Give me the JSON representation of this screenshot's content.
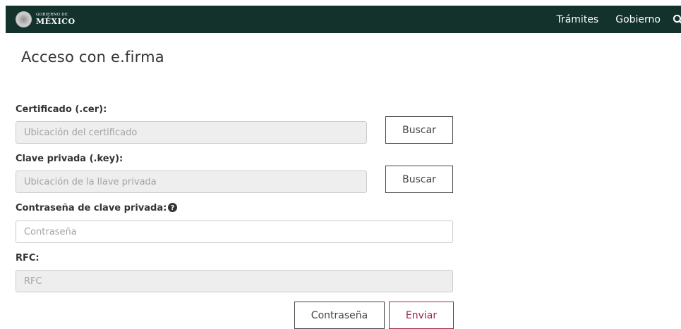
{
  "header": {
    "logo_small": "GOBIERNO DE",
    "logo_big": "MÉXICO",
    "nav": [
      {
        "label": "Trámites"
      },
      {
        "label": "Gobierno"
      }
    ],
    "background_color": "#13322b"
  },
  "page": {
    "title": "Acceso con e.firma"
  },
  "form": {
    "certificado": {
      "label": "Certificado (.cer):",
      "placeholder": "Ubicación del certificado",
      "button": "Buscar"
    },
    "clave_privada": {
      "label": "Clave privada (.key):",
      "placeholder": "Ubicación de la llave privada",
      "button": "Buscar"
    },
    "contrasena": {
      "label": "Contraseña de clave privada:",
      "placeholder": "Contraseña"
    },
    "rfc": {
      "label": "RFC:",
      "placeholder": "RFC"
    },
    "buttons": {
      "contrasena": "Contraseña",
      "enviar": "Enviar"
    },
    "accent_color": "#9d2449"
  }
}
